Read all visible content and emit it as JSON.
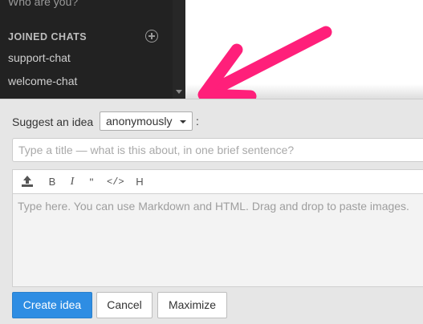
{
  "sidebar": {
    "who_are_you": "Who are you?",
    "joined_heading": "JOINED CHATS",
    "chats": [
      "support-chat",
      "welcome-chat"
    ]
  },
  "editor": {
    "suggest_label": "Suggest an idea",
    "author_mode": "anonymously",
    "colon": ":",
    "title_placeholder": "Type a title — what is this about, in one brief sentence?",
    "toolbar": {
      "bold": "B",
      "italic": "I",
      "quote": "\"",
      "code": "</>",
      "heading": "H"
    },
    "body_placeholder": "Type here. You can use Markdown and HTML. Drag and drop to paste images.",
    "buttons": {
      "create": "Create idea",
      "cancel": "Cancel",
      "maximize": "Maximize"
    }
  },
  "colors": {
    "sidebar_bg": "#222222",
    "primary": "#2e8de3",
    "annotation_arrow": "#ff1f7a"
  },
  "icons": [
    "add-circle-icon",
    "scroll-down-icon",
    "caret-down-icon",
    "upload-icon",
    "annotation-arrow-icon"
  ]
}
